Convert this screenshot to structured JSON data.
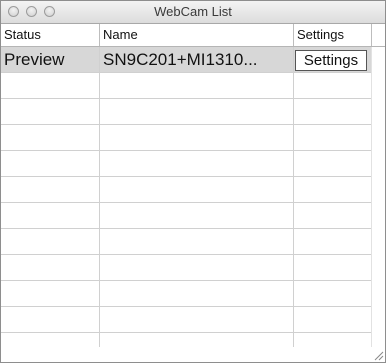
{
  "window": {
    "title": "WebCam List"
  },
  "columns": [
    {
      "label": "Status"
    },
    {
      "label": "Name"
    },
    {
      "label": "Settings"
    }
  ],
  "rows": [
    {
      "status": "Preview",
      "name": "SN9C201+MI1310...",
      "settings_label": "Settings"
    }
  ]
}
